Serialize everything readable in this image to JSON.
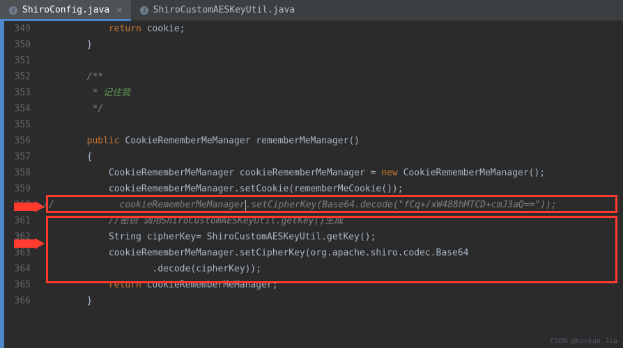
{
  "tabs": [
    {
      "label": "ShiroConfig.java",
      "active": true
    },
    {
      "label": "ShiroCustomAESKeyUtil.java",
      "active": false
    }
  ],
  "gutter": {
    "start": 349,
    "end": 366
  },
  "code": {
    "l349": {
      "kw": "return",
      "ident": " cookie;"
    },
    "l350": "        }",
    "l351": "",
    "l352": "        /**",
    "l353_star": "         * ",
    "l353_txt": "记住我",
    "l354": "         */",
    "l355_public": "public",
    "l355_sig": " CookieRememberMeManager rememberMeManager()",
    "l356": "        {",
    "l357_a": "            CookieRememberMeManager cookieRememberMeManager = ",
    "l357_new": "new",
    "l357_b": " CookieRememberMeManager();",
    "l358": "            cookieRememberMeManager.setCookie(rememberMeCookie());",
    "l359_slash": "//",
    "l359_body": "            cookieRememberMeManager",
    "l359_rest": ".setCipherKey(Base64.decode(",
    "l359_str": "\"fCq+/xW488hMTCD+cmJ3aQ==\"",
    "l359_end": "));",
    "l360_slash": "            //",
    "l360_txt": "密钥 调用ShiroCustomAESKeyUtil.getKey()生成",
    "l361": "            String cipherKey= ShiroCustomAESKeyUtil.getKey();",
    "l362": "            cookieRememberMeManager.setCipherKey(org.apache.shiro.codec.Base64",
    "l363": "                    .decode(cipherKey));",
    "l364_kw": "return",
    "l364_rest": " cookieRememberMeManager;",
    "l365": "        }",
    "l366": ""
  },
  "watermark": "CSDN @haokan_Jia"
}
